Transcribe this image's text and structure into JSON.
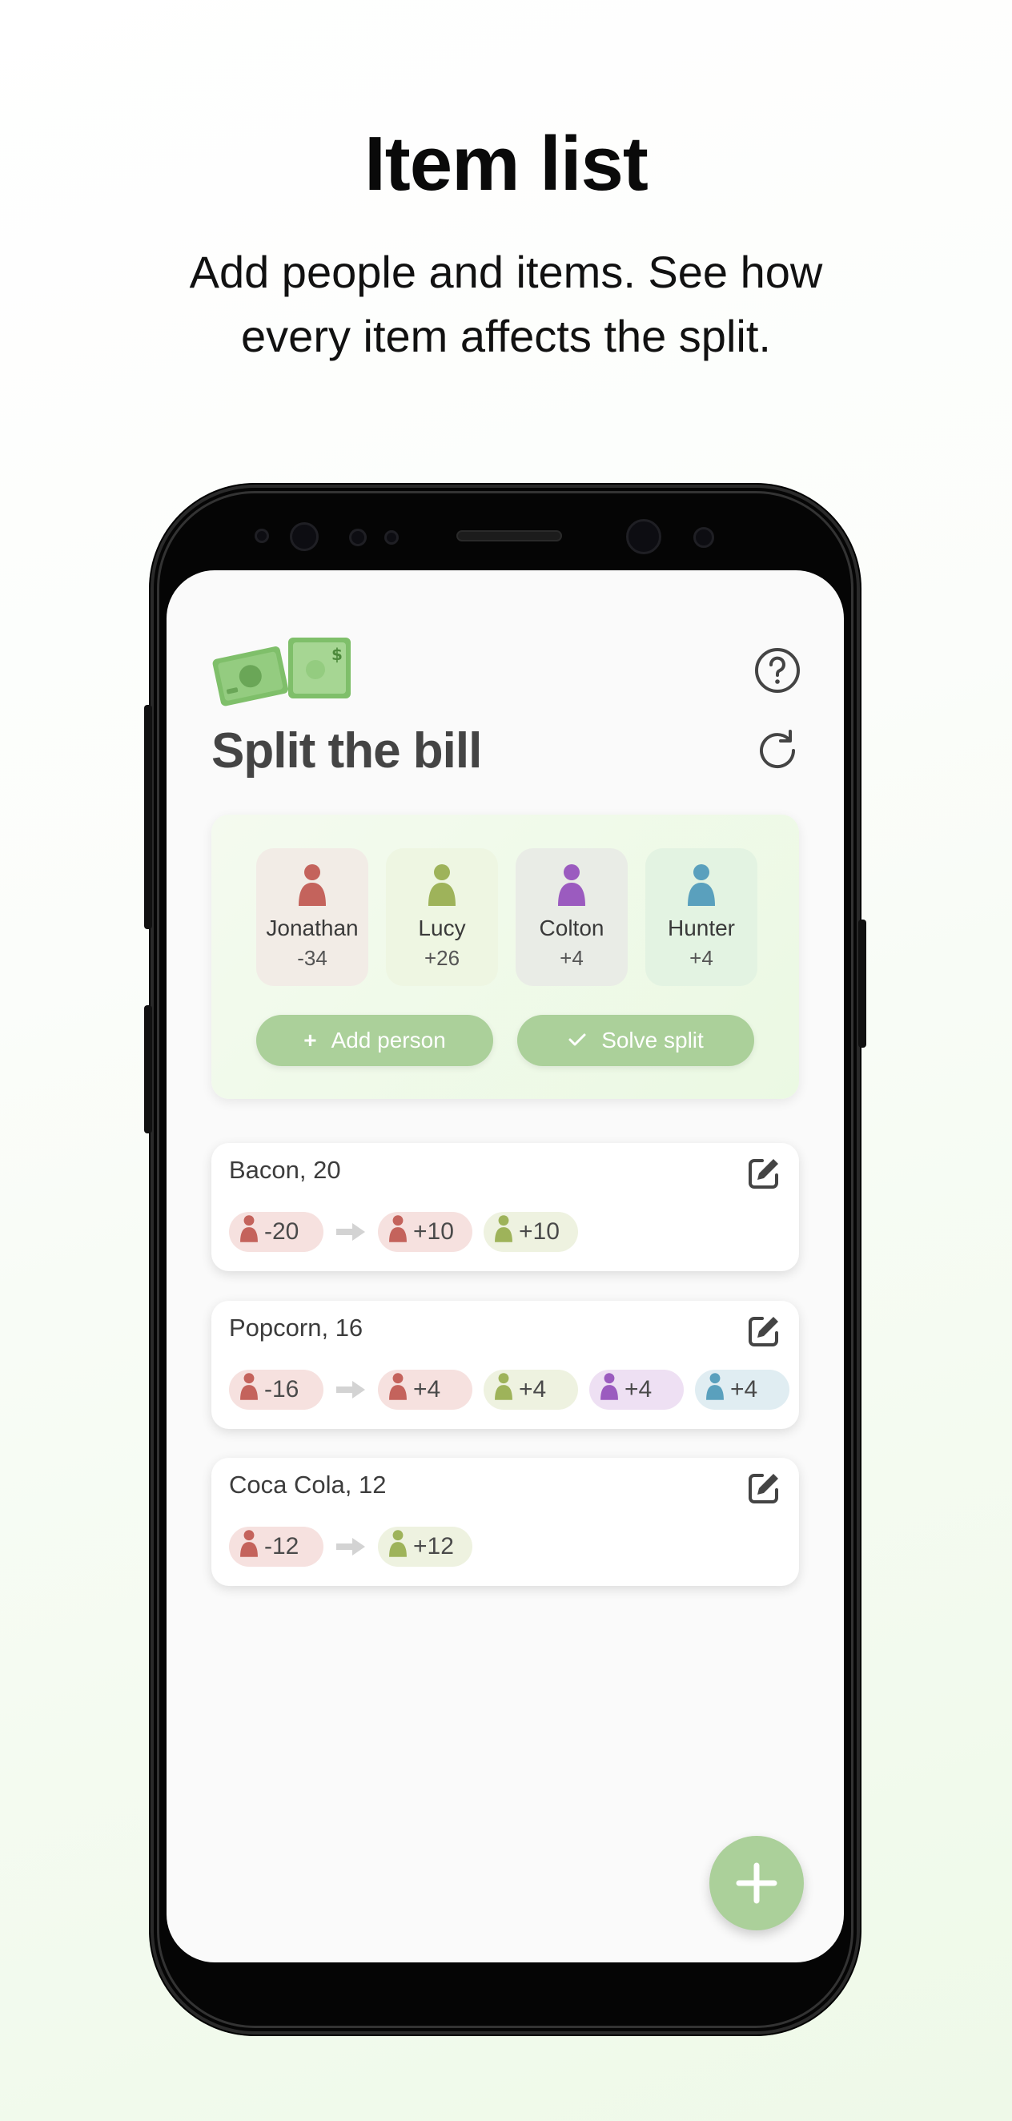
{
  "hero": {
    "title": "Item list",
    "subtitle_line1": "Add people and items. See how",
    "subtitle_line2": "every item affects the split."
  },
  "app": {
    "title": "Split the bill",
    "logo_icon": "money-bills-icon",
    "help_icon": "help-circle-icon",
    "reset_icon": "refresh-icon"
  },
  "people": [
    {
      "name": "Jonathan",
      "balance": "-34",
      "color": "#c4635c",
      "bg": "#f2ece6"
    },
    {
      "name": "Lucy",
      "balance": "+26",
      "color": "#9eb35a",
      "bg": "#eef6e2"
    },
    {
      "name": "Colton",
      "balance": "+4",
      "color": "#9b5bbf",
      "bg": "#e9ece6"
    },
    {
      "name": "Hunter",
      "balance": "+4",
      "color": "#5aa0bd",
      "bg": "#e3f3e2"
    }
  ],
  "actions": {
    "add_person": "Add person",
    "solve_split": "Solve split"
  },
  "items": [
    {
      "title": "Bacon, 20",
      "payer": {
        "amount": "-20",
        "person": "Jonathan"
      },
      "shares": [
        {
          "amount": "+10",
          "person": "Jonathan"
        },
        {
          "amount": "+10",
          "person": "Lucy"
        }
      ]
    },
    {
      "title": "Popcorn, 16",
      "payer": {
        "amount": "-16",
        "person": "Jonathan"
      },
      "shares": [
        {
          "amount": "+4",
          "person": "Jonathan"
        },
        {
          "amount": "+4",
          "person": "Lucy"
        },
        {
          "amount": "+4",
          "person": "Colton"
        },
        {
          "amount": "+4",
          "person": "Hunter"
        }
      ]
    },
    {
      "title": "Coca Cola, 12",
      "payer": {
        "amount": "-12",
        "person": "Jonathan"
      },
      "shares": [
        {
          "amount": "+12",
          "person": "Lucy"
        }
      ]
    }
  ],
  "colors": {
    "accent_green": "#abd09a",
    "chip_bg": {
      "Jonathan": "#f6e1df",
      "Lucy": "#eef2e0",
      "Colton": "#eee0f3",
      "Hunter": "#e0edf2"
    }
  },
  "fab_icon": "plus-icon"
}
